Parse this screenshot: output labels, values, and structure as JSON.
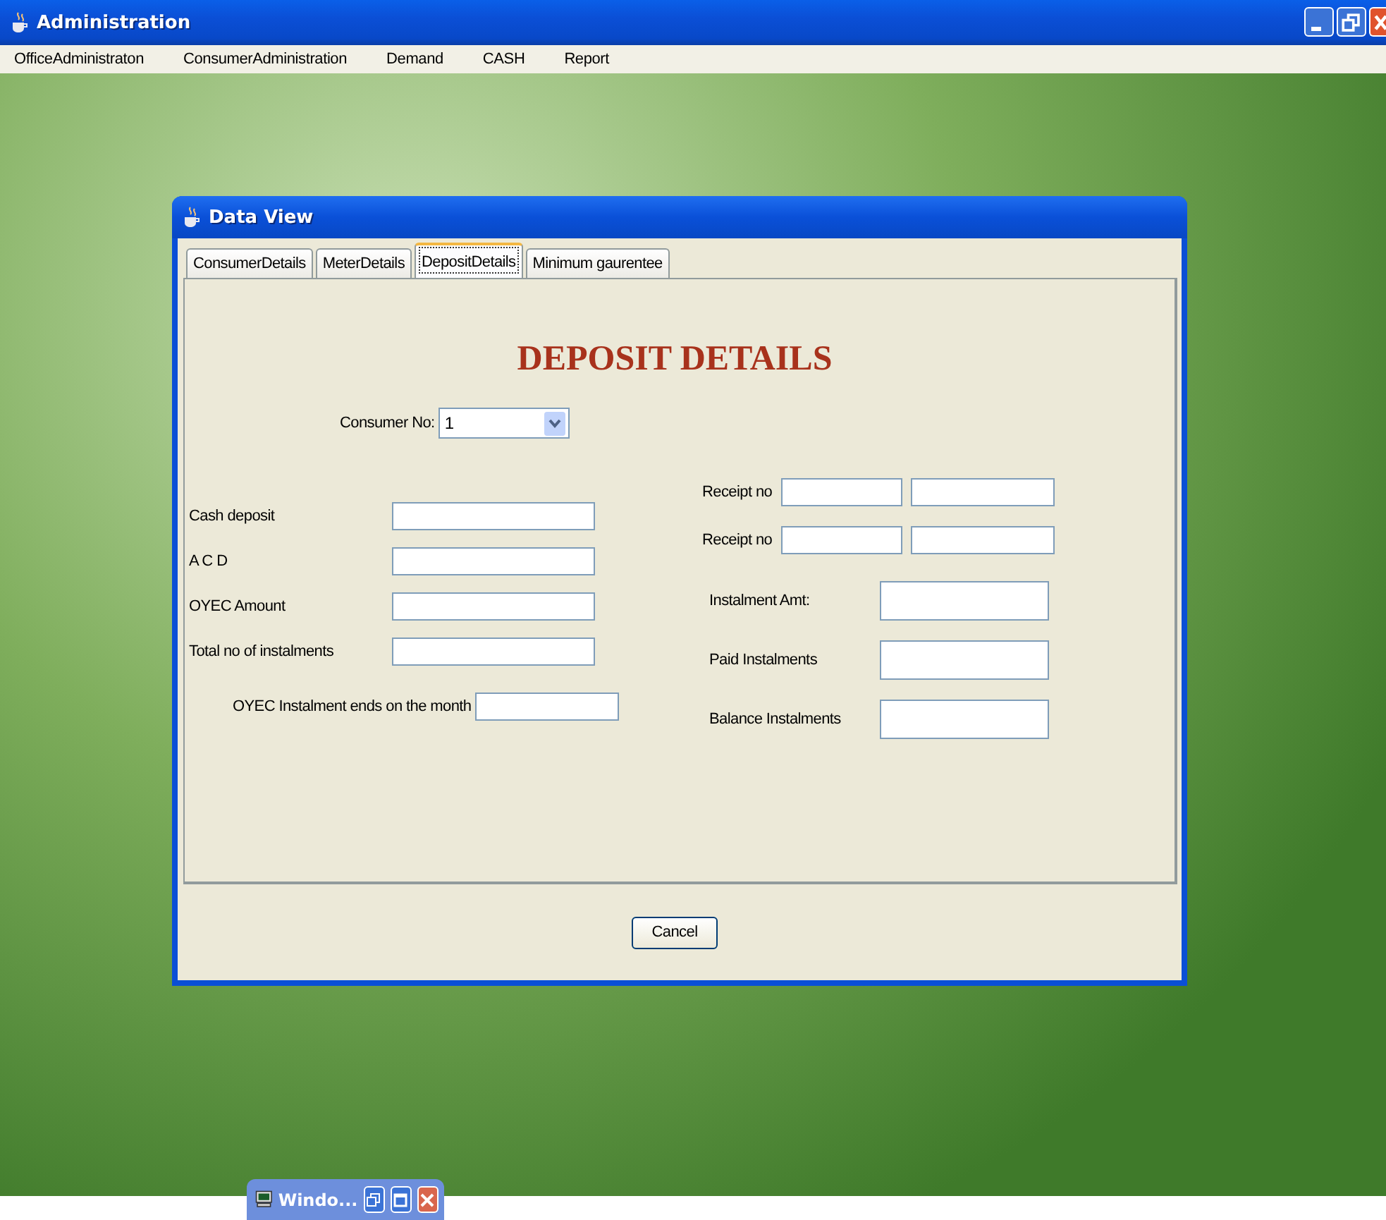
{
  "window": {
    "title": "Administration"
  },
  "menu": [
    {
      "label": "OfficeAdministraton"
    },
    {
      "label": "ConsumerAdministration"
    },
    {
      "label": "Demand"
    },
    {
      "label": "CASH"
    },
    {
      "label": "Report"
    }
  ],
  "dialog": {
    "title": "Data View",
    "tabs": [
      {
        "label": "ConsumerDetails",
        "selected": false
      },
      {
        "label": "MeterDetails",
        "selected": false
      },
      {
        "label": "DepositDetails",
        "selected": true
      },
      {
        "label": "Minimum gaurentee",
        "selected": false
      }
    ],
    "heading": "DEPOSIT DETAILS",
    "consumer_no": {
      "label": "Consumer No:",
      "value": "1"
    },
    "left_fields": [
      {
        "label": "Cash deposit"
      },
      {
        "label": "A C D"
      },
      {
        "label": "OYEC Amount"
      },
      {
        "label": "Total no of instalments"
      }
    ],
    "month_field": {
      "label": "OYEC Instalment ends on the month"
    },
    "receipts": [
      {
        "label": "Receipt no"
      },
      {
        "label": "Receipt no"
      }
    ],
    "right_fields": [
      {
        "label": "Instalment Amt:"
      },
      {
        "label": "Paid Instalments"
      },
      {
        "label": "Balance Instalments"
      }
    ],
    "buttons": [
      {
        "label": "Cancel"
      }
    ]
  },
  "minimized_window": {
    "title": "Windo..."
  }
}
